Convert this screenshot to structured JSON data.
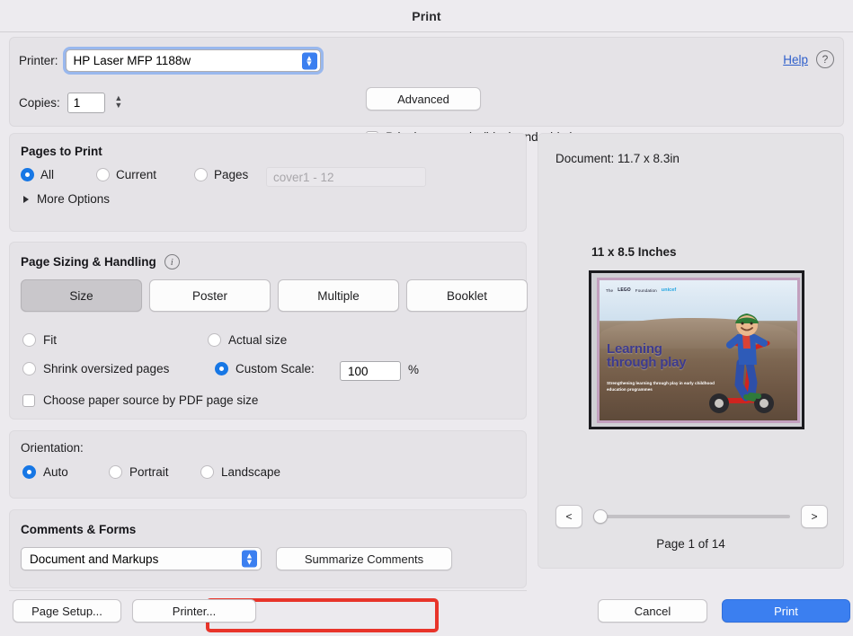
{
  "window": {
    "title": "Print"
  },
  "printer_row": {
    "label": "Printer:",
    "selected_printer": "HP Laser MFP 1188w",
    "advanced_label": "Advanced",
    "help_label": "Help",
    "help_icon": "question-circle-icon"
  },
  "copies_row": {
    "label": "Copies:",
    "value": "1",
    "grayscale_label": "Print in grayscale (black and white)",
    "grayscale_checked": false
  },
  "pages_to_print": {
    "title": "Pages to Print",
    "options": [
      {
        "label": "All",
        "selected": true
      },
      {
        "label": "Current",
        "selected": false
      },
      {
        "label": "Pages",
        "selected": false
      }
    ],
    "range_placeholder": "cover1 - 12",
    "range_value": "",
    "more_options_label": "More Options"
  },
  "page_sizing": {
    "title": "Page Sizing & Handling",
    "info_icon": "info-circle-icon",
    "modes": [
      {
        "label": "Size",
        "selected": true
      },
      {
        "label": "Poster",
        "selected": false
      },
      {
        "label": "Multiple",
        "selected": false
      },
      {
        "label": "Booklet",
        "selected": false
      }
    ],
    "fit_label": "Fit",
    "fit_selected": false,
    "actual_size_label": "Actual size",
    "actual_size_selected": false,
    "shrink_label": "Shrink oversized pages",
    "shrink_selected": false,
    "custom_scale_label": "Custom Scale:",
    "custom_scale_selected": true,
    "custom_scale_value": "100",
    "percent_symbol": "%",
    "highlight_color": "#E8342A",
    "paper_source_label": "Choose paper source by PDF page size",
    "paper_source_checked": false
  },
  "orientation": {
    "title": "Orientation:",
    "options": [
      {
        "label": "Auto",
        "selected": true
      },
      {
        "label": "Portrait",
        "selected": false
      },
      {
        "label": "Landscape",
        "selected": false
      }
    ]
  },
  "comments_forms": {
    "title": "Comments & Forms",
    "selected": "Document and Markups",
    "summarize_label": "Summarize Comments"
  },
  "preview": {
    "document_size": "Document: 11.7 x 8.3in",
    "paper_size": "11 x 8.5 Inches",
    "page_count_label": "Page 1 of 14",
    "prev_label": "<",
    "next_label": ">",
    "cover": {
      "brand_prefix": "The",
      "brand_name": "LEGO",
      "brand_suffix": "Foundation",
      "partner": "unicef",
      "title_line1": "Learning",
      "title_line2": "through play",
      "subtitle": "Strengthening learning through play in early childhood education programmes"
    }
  },
  "footer": {
    "page_setup_label": "Page Setup...",
    "printer_label": "Printer...",
    "cancel_label": "Cancel",
    "print_label": "Print",
    "print_accent": "#3B7FF0"
  }
}
